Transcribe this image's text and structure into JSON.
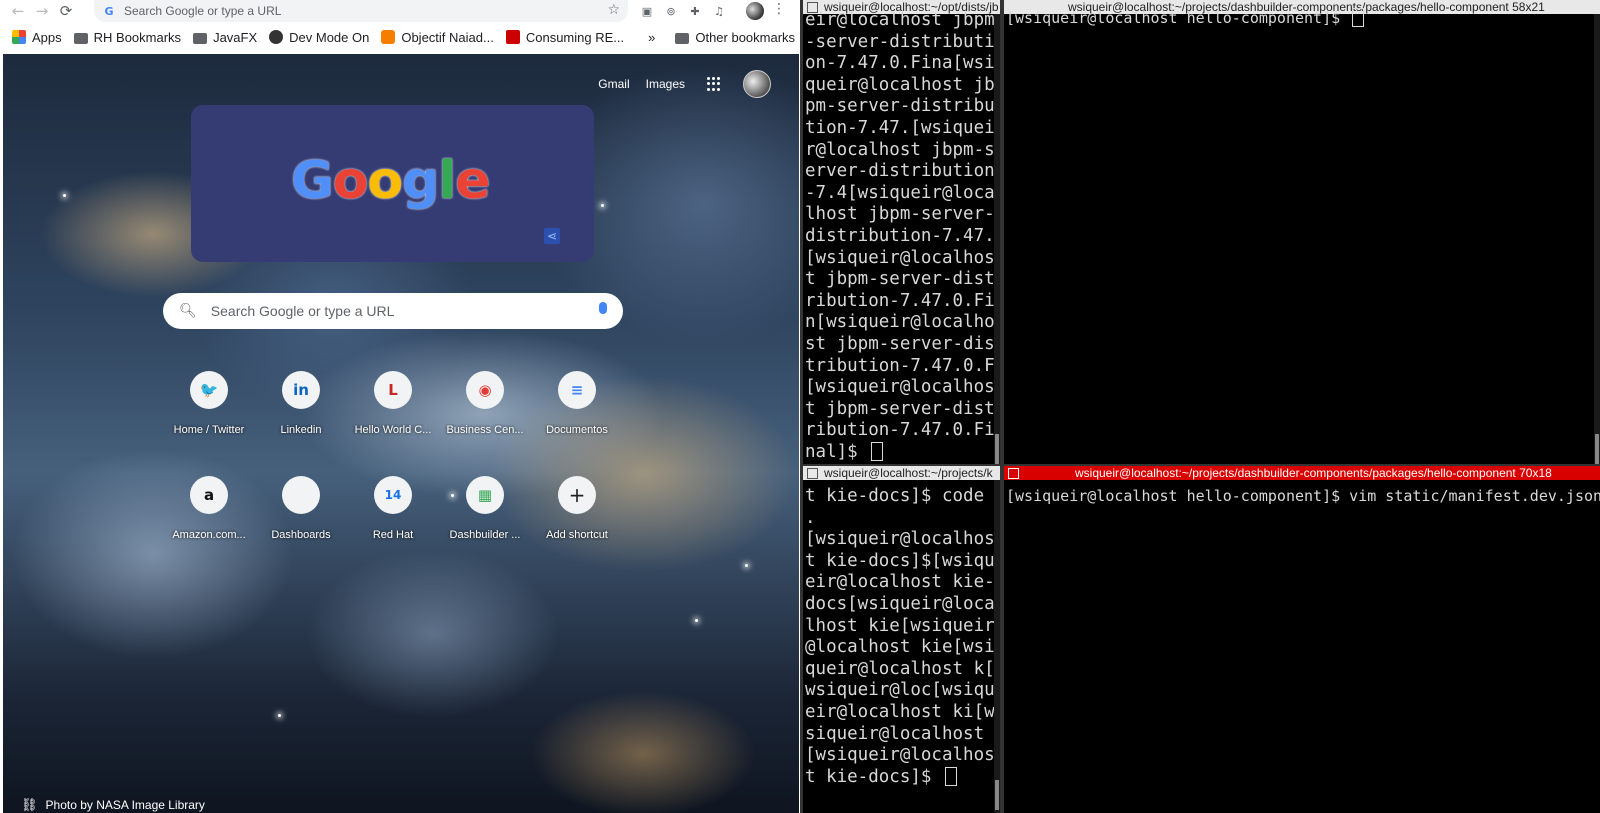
{
  "chrome": {
    "nav": {
      "back": "←",
      "forward": "→",
      "reload": "⟳"
    },
    "omnibox_placeholder": "Search Google or type a URL",
    "bookmarks": [
      {
        "label": "Apps"
      },
      {
        "label": "RH Bookmarks"
      },
      {
        "label": "JavaFX"
      },
      {
        "label": "Dev Mode On"
      },
      {
        "label": "Objectif Naiad..."
      },
      {
        "label": "Consuming RE..."
      }
    ],
    "bookmarks_overflow": "»",
    "other_bookmarks": "Other bookmarks",
    "top_links": {
      "gmail": "Gmail",
      "images": "Images"
    },
    "doodle_letters": [
      {
        "ch": "G",
        "color": "#4f8ff7"
      },
      {
        "ch": "o",
        "color": "#ea4335"
      },
      {
        "ch": "o",
        "color": "#fbbc05"
      },
      {
        "ch": "g",
        "color": "#4f8ff7"
      },
      {
        "ch": "l",
        "color": "#34a853"
      },
      {
        "ch": "e",
        "color": "#ea4335"
      }
    ],
    "search_placeholder": "Search Google or type a URL",
    "shortcuts_row1": [
      {
        "label": "Home / Twitter",
        "glyph": "🐦",
        "color": "#1da1f2"
      },
      {
        "label": "Linkedin",
        "glyph": "in",
        "color": "#0a66c2"
      },
      {
        "label": "Hello World C...",
        "glyph": "L",
        "color": "#c62828"
      },
      {
        "label": "Business Cen...",
        "glyph": "◉",
        "color": "#e53935"
      },
      {
        "label": "Documentos",
        "glyph": "≡",
        "color": "#4285f4"
      }
    ],
    "shortcuts_row2": [
      {
        "label": "Amazon.com...",
        "glyph": "a",
        "color": "#111"
      },
      {
        "label": "Dashboards",
        "glyph": "",
        "color": "#999"
      },
      {
        "label": "Red Hat",
        "glyph": "14",
        "color": "#1a73e8"
      },
      {
        "label": "Dashbuilder ...",
        "glyph": "▦",
        "color": "#34a853"
      },
      {
        "label": "Add shortcut",
        "glyph": "+",
        "color": "#202124"
      }
    ],
    "credit": "Photo by NASA Image Library"
  },
  "terminals": {
    "top_left": {
      "title": "wsiqueir@localhost:~/opt/dists/jb",
      "lines": [
        "eir@localhost jbpm",
        "-server-distributio",
        "on-7.47.0.Fina[wsi",
        "queir@localhost jb",
        "pm-server-distribu",
        "tion-7.47.[wsiquei",
        "r@localhost jbpm-s",
        "erver-distribution",
        "-7.4[wsiqueir@loca",
        "lhost jbpm-server-",
        "distribution-7.47.",
        "[wsiqueir@localhos",
        "t jbpm-server-dist",
        "ribution-7.47.0.Fi",
        "n[wsiqueir@localho",
        "st jbpm-server-dis",
        "tribution-7.47.0.F",
        "[wsiqueir@localhos",
        "t jbpm-server-dist",
        "ribution-7.47.0.Fi",
        "nal]$ "
      ]
    },
    "top_right": {
      "title": "wsiqueir@localhost:~/projects/dashbuilder-components/packages/hello-component 58x21",
      "lines": [
        "[wsiqueir@localhost hello-component]$ "
      ]
    },
    "bottom_left": {
      "title": "wsiqueir@localhost:~/projects/k",
      "lines": [
        "t kie-docs]$ code",
        ".",
        "[wsiqueir@localhos",
        "t kie-docs]$[wsiqu",
        "eir@localhost kie-",
        "docs[wsiqueir@loca",
        "lhost kie[wsiqueir",
        "@localhost kie[wsi",
        "queir@localhost k[",
        "wsiqueir@loc[wsiqu",
        "eir@localhost ki[w",
        "siqueir@localhost ",
        "[wsiqueir@localhos",
        "t kie-docs]$ "
      ]
    },
    "bottom_right": {
      "title": "wsiqueir@localhost:~/projects/dashbuilder-components/packages/hello-component 70x18",
      "lines": [
        "[wsiqueir@localhost hello-component]$ vim static/manifest.dev.json"
      ]
    }
  }
}
